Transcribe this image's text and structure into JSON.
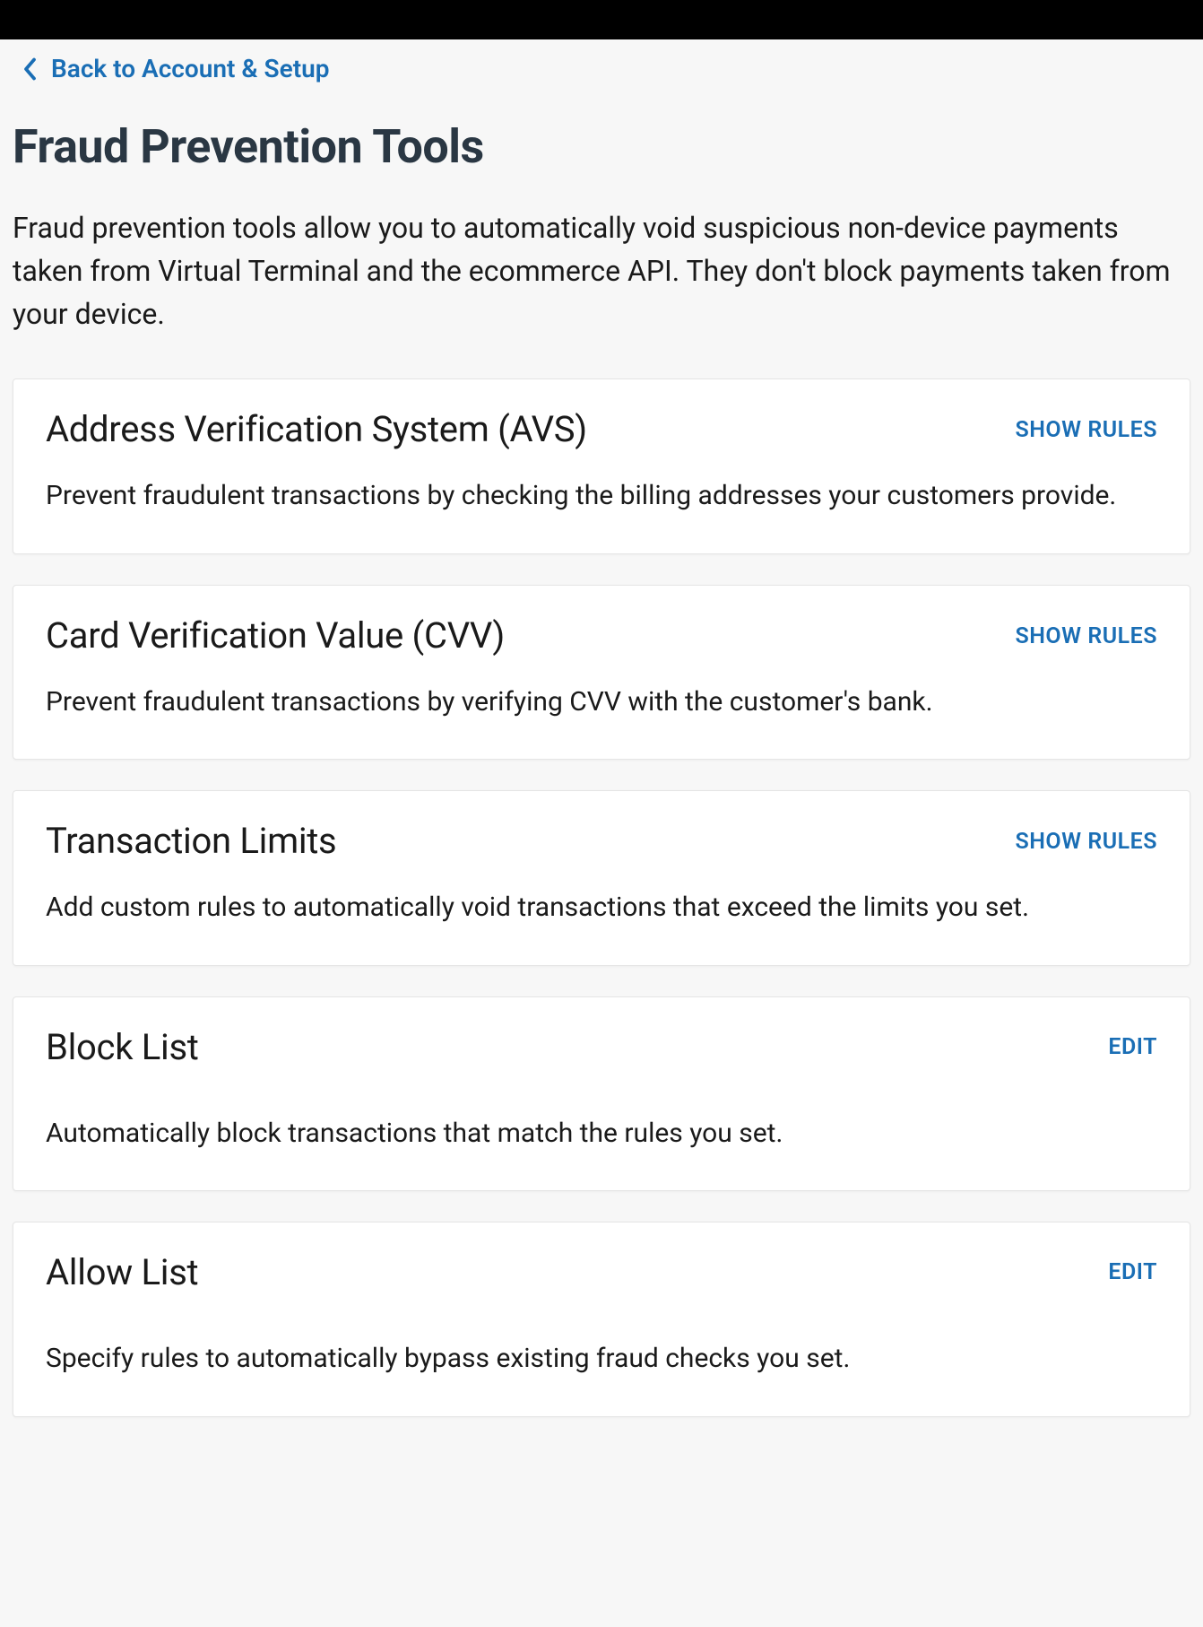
{
  "nav": {
    "back_label": "Back to Account & Setup"
  },
  "page": {
    "title": "Fraud Prevention Tools",
    "description": "Fraud prevention tools allow you to automatically void suspicious non-device payments taken from Virtual Terminal and the ecommerce API. They don't block payments taken from your device."
  },
  "cards": {
    "avs": {
      "title": "Address Verification System (AVS)",
      "action": "SHOW RULES",
      "description": "Prevent fraudulent transactions by checking the billing addresses your customers provide."
    },
    "cvv": {
      "title": "Card Verification Value (CVV)",
      "action": "SHOW RULES",
      "description": "Prevent fraudulent transactions by verifying CVV with the customer's bank."
    },
    "limits": {
      "title": "Transaction Limits",
      "action": "SHOW RULES",
      "description": "Add custom rules to automatically void transactions that exceed the limits you set."
    },
    "block_list": {
      "title": "Block List",
      "action": "EDIT",
      "description": "Automatically block transactions that match the rules you set."
    },
    "allow_list": {
      "title": "Allow List",
      "action": "EDIT",
      "description": "Specify rules to automatically bypass existing fraud checks you set."
    }
  }
}
